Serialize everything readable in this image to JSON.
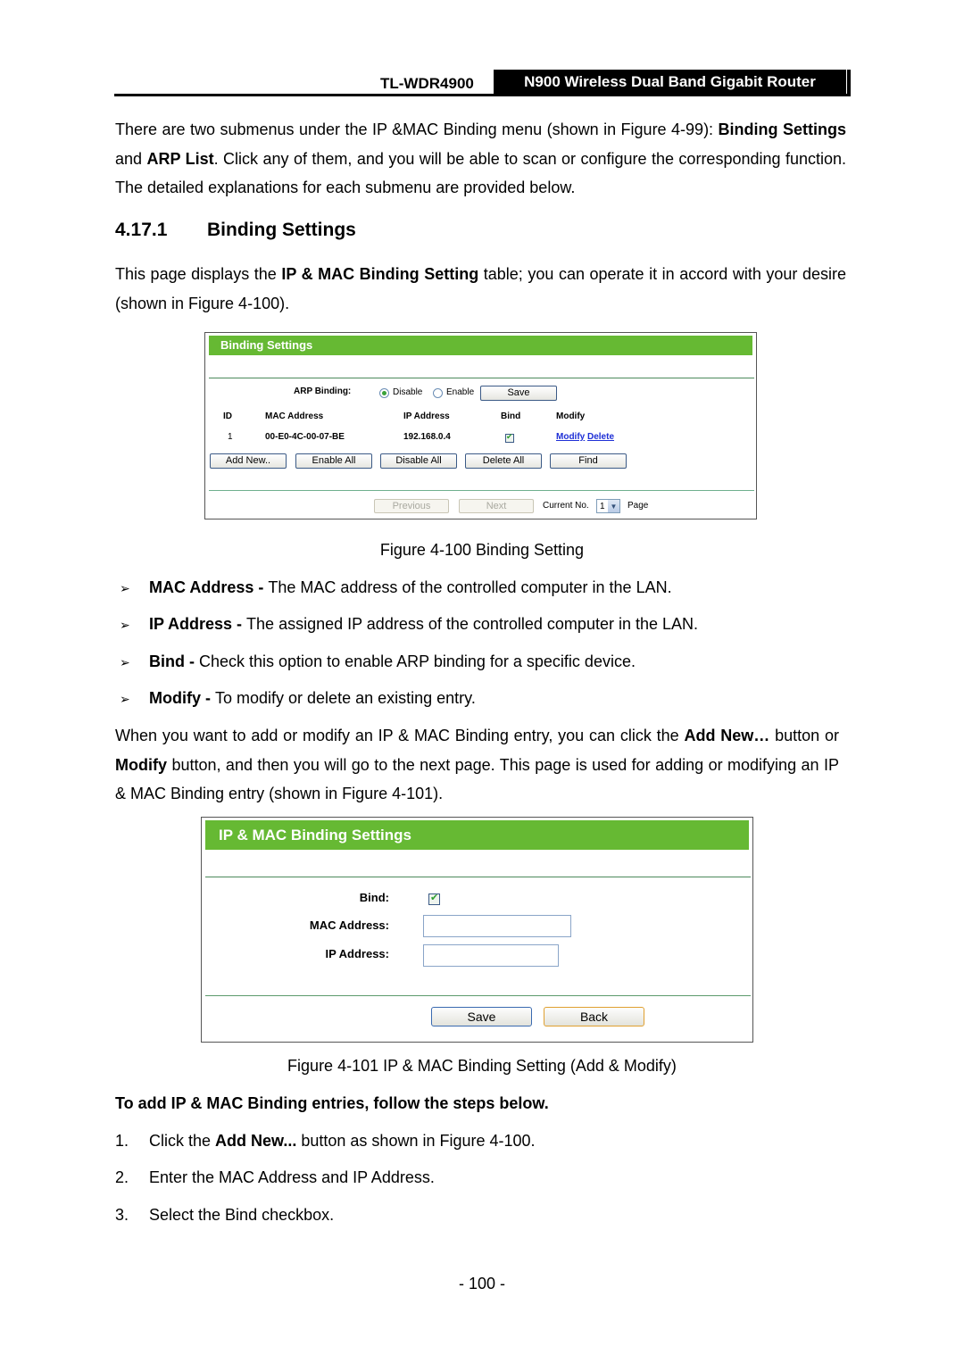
{
  "header": {
    "model": "TL-WDR4900",
    "product": "N900 Wireless Dual Band Gigabit Router"
  },
  "intro": {
    "t1": "There are two submenus under the IP &MAC Binding menu (shown in Figure 4-99): ",
    "b1": "Binding Settings",
    "t2": " and ",
    "b2": "ARP List",
    "t3": ". Click any of them, and you will be able to scan or configure the corresponding function. The detailed explanations for each submenu are provided below."
  },
  "section": {
    "number": "4.17.1",
    "title": "Binding Settings"
  },
  "para2": {
    "t1": "This page displays the ",
    "b1": "IP & MAC Binding Setting",
    "t2": " table; you can operate it in accord with your desire (shown in Figure 4-100)."
  },
  "figure1": {
    "header": "Binding Settings",
    "arp_label": "ARP Binding:",
    "radio_disable": "Disable",
    "radio_enable": "Enable",
    "arp_selected": "Disable",
    "save": "Save",
    "columns": [
      "ID",
      "MAC Address",
      "IP Address",
      "Bind",
      "Modify"
    ],
    "rows": [
      {
        "id": "1",
        "mac": "00-E0-4C-00-07-BE",
        "ip": "192.168.0.4",
        "bind": true,
        "modify": "Modify",
        "delete": "Delete"
      }
    ],
    "buttons": [
      "Add New..",
      "Enable All",
      "Disable All",
      "Delete All",
      "Find"
    ],
    "previous": "Previous",
    "next": "Next",
    "current_no_label": "Current No.",
    "current_no": "1",
    "page_label": "Page",
    "caption": "Figure 4-100 Binding Setting"
  },
  "bullets": [
    {
      "term": "MAC Address - ",
      "text": "The MAC address of the controlled computer in the LAN."
    },
    {
      "term": "IP Address - ",
      "text": "The assigned IP address of the controlled computer in the LAN."
    },
    {
      "term": "Bind - ",
      "text": "Check this option to enable ARP binding for a specific device."
    },
    {
      "term": "Modify - ",
      "text": "To modify or delete an existing entry."
    }
  ],
  "para3": {
    "t1": "When you want to add or modify an IP & MAC Binding entry, you can click the ",
    "b1": "Add New…",
    "t2": " button or ",
    "b2": "Modify",
    "t3": " button, and then you will go to the next page. This page is used for adding or modifying an IP & MAC Binding entry (shown in Figure 4-101)."
  },
  "figure2": {
    "header": "IP & MAC Binding Settings",
    "bind_label": "Bind:",
    "bind_checked": true,
    "mac_label": "MAC Address:",
    "mac_value": "",
    "ip_label": "IP Address:",
    "ip_value": "",
    "save": "Save",
    "back": "Back",
    "caption": "Figure 4-101 IP & MAC Binding Setting (Add & Modify)"
  },
  "steps_heading": "To add IP & MAC Binding entries, follow the steps below.",
  "steps": [
    {
      "n": "1.",
      "t1": "Click the ",
      "b": "Add New...",
      "t2": " button as shown in Figure 4-100."
    },
    {
      "n": "2.",
      "t1": "Enter the MAC Address and IP Address.",
      "b": "",
      "t2": ""
    },
    {
      "n": "3.",
      "t1": "Select the Bind checkbox.",
      "b": "",
      "t2": ""
    }
  ],
  "page_number": "- 100 -"
}
